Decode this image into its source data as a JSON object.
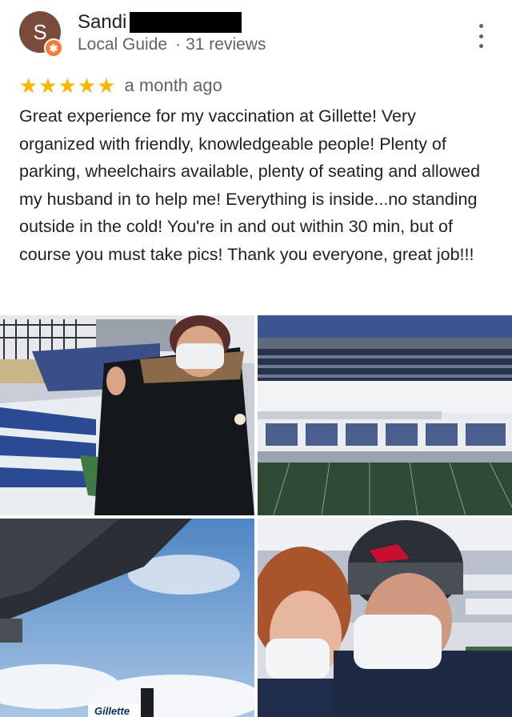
{
  "reviewer": {
    "avatar_letter": "S",
    "name": "Sandi",
    "badge_symbol": "✱",
    "role": "Local Guide",
    "separator": "·",
    "review_count": "31 reviews"
  },
  "review": {
    "rating": 5,
    "stars": "★★★★★",
    "time": "a month ago",
    "text": "Great experience for my vaccination at Gillette! Very organized with friendly, knowledgeable people! Plenty of parking, wheelchairs available,  plenty of seating and allowed my husband in to help me! Everything is inside...no standing outside in the cold! You're in and out within 30 min, but of course you must take pics! Thank you everyone, great job!!!"
  },
  "photos": {
    "count": 4,
    "sign_text": "Gillette"
  },
  "colors": {
    "star": "#f7b500",
    "badge": "#f57c32",
    "avatar": "#7a4a3a",
    "secondary_text": "#5f6368"
  },
  "icons": {
    "more": "more-vert-icon",
    "badge": "local-guide-badge-icon",
    "star": "star-icon"
  }
}
